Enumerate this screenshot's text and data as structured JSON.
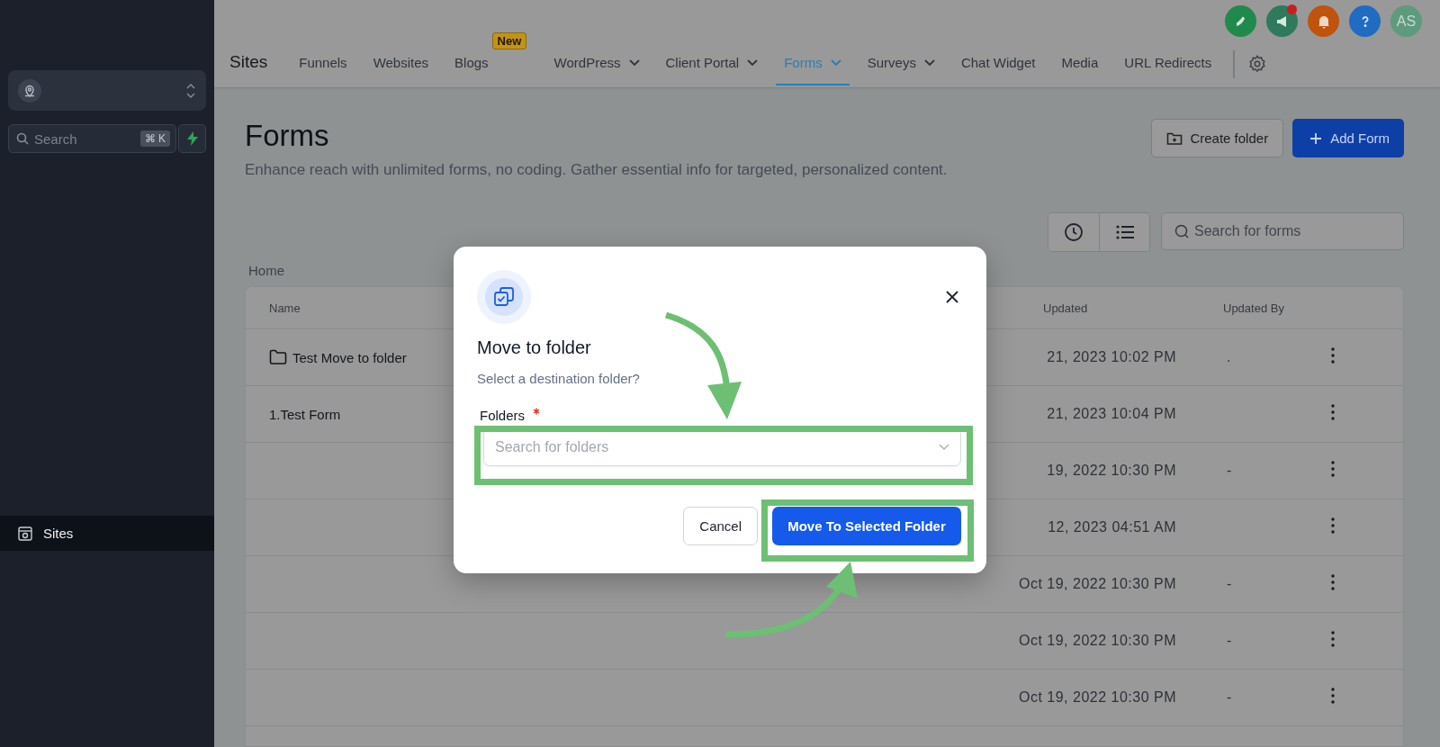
{
  "sidebar": {
    "search": {
      "placeholder": "Search",
      "shortcut": "⌘ K"
    },
    "items": [
      {
        "label": "Sites",
        "selected": true
      }
    ]
  },
  "header": {
    "title": "Sites",
    "tabs": [
      {
        "label": "Funnels",
        "selected": false,
        "dropdown": false
      },
      {
        "label": "Websites",
        "selected": false,
        "dropdown": false
      },
      {
        "label": "Blogs",
        "selected": false,
        "dropdown": false,
        "badge": "New"
      },
      {
        "label": "WordPress",
        "selected": false,
        "dropdown": true
      },
      {
        "label": "Client Portal",
        "selected": false,
        "dropdown": true
      },
      {
        "label": "Forms",
        "selected": true,
        "dropdown": true
      },
      {
        "label": "Surveys",
        "selected": false,
        "dropdown": true
      },
      {
        "label": "Chat Widget",
        "selected": false,
        "dropdown": false
      },
      {
        "label": "Media",
        "selected": false,
        "dropdown": false
      },
      {
        "label": "URL Redirects",
        "selected": false,
        "dropdown": false
      }
    ],
    "announcements_unread": true,
    "avatar": "AS"
  },
  "page": {
    "title": "Forms",
    "description": "Enhance reach with unlimited forms, no coding. Gather essential info for targeted, personalized content.",
    "create_folder": "Create folder",
    "add_form": "Add Form",
    "search": {
      "placeholder": "Search for forms"
    },
    "breadcrumb": "Home"
  },
  "table": {
    "columns": [
      "Name",
      "Updated",
      "Updated By"
    ],
    "rows": [
      {
        "kind": "folder",
        "name": "Test Move to folder",
        "updated": "21, 2023 10:02 PM",
        "updated_by": "."
      },
      {
        "kind": "form",
        "name": "1.Test Form",
        "updated": "21, 2023 10:04 PM"
      },
      {
        "kind": "form",
        "updated": "19, 2022 10:30 PM",
        "updated_by": "-"
      },
      {
        "kind": "form",
        "updated": "12, 2023 04:51 AM"
      },
      {
        "kind": "form",
        "updated": "Oct 19, 2022 10:30 PM",
        "updated_by": "-"
      },
      {
        "kind": "form",
        "updated": "Oct 19, 2022 10:30 PM",
        "updated_by": "-"
      },
      {
        "kind": "form",
        "updated": "Oct 19, 2022 10:30 PM",
        "updated_by": "-"
      }
    ]
  },
  "dialog": {
    "title": "Move to folder",
    "subtitle": "Select a destination folder?",
    "field_label": "Folders",
    "required": true,
    "placeholder": "Search for folders",
    "cancel": "Cancel",
    "confirm": "Move To Selected Folder"
  }
}
